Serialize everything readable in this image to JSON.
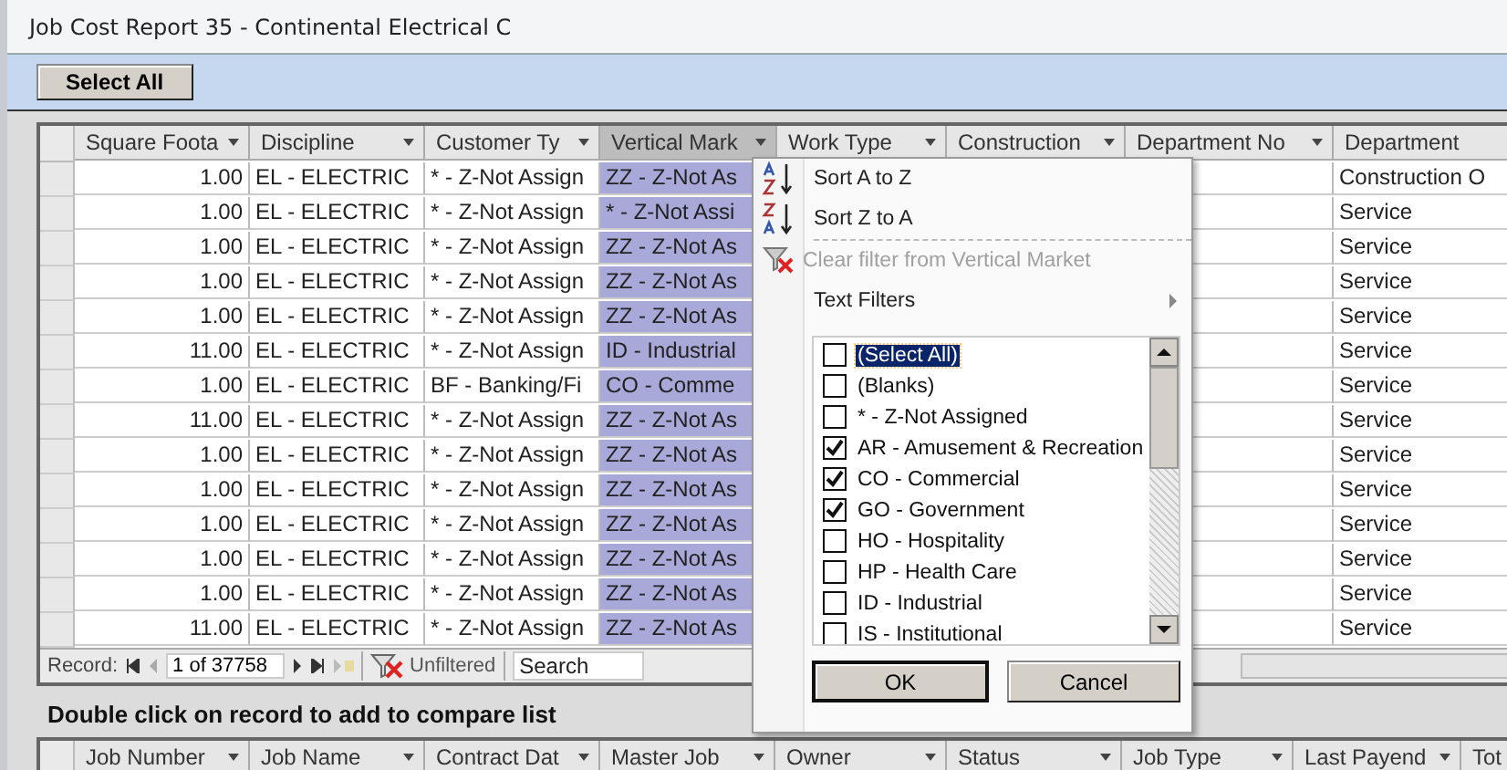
{
  "window": {
    "title": "Job Cost Report 35 - Continental Electrical C"
  },
  "toolbar": {
    "select_all_button": "Select All"
  },
  "records_grid": {
    "columns": [
      {
        "label": "Square Foota",
        "selected": false
      },
      {
        "label": "Discipline",
        "selected": false
      },
      {
        "label": "Customer Ty",
        "selected": false
      },
      {
        "label": "Vertical Mark",
        "selected": true
      },
      {
        "label": "Work Type",
        "selected": false
      },
      {
        "label": "Construction",
        "selected": false
      },
      {
        "label": "Department No",
        "selected": false
      },
      {
        "label": "Department",
        "selected": false
      }
    ],
    "rows": [
      {
        "square_footage": "1.00",
        "discipline": "EL - ELECTRIC",
        "customer_type": "* - Z-Not Assign",
        "vertical_market": "ZZ - Z-Not As",
        "department": "Construction O"
      },
      {
        "square_footage": "1.00",
        "discipline": "EL - ELECTRIC",
        "customer_type": "* - Z-Not Assign",
        "vertical_market": "* - Z-Not Assi",
        "department": "Service"
      },
      {
        "square_footage": "1.00",
        "discipline": "EL - ELECTRIC",
        "customer_type": "* - Z-Not Assign",
        "vertical_market": "ZZ - Z-Not As",
        "department": "Service"
      },
      {
        "square_footage": "1.00",
        "discipline": "EL - ELECTRIC",
        "customer_type": "* - Z-Not Assign",
        "vertical_market": "ZZ - Z-Not As",
        "department": "Service"
      },
      {
        "square_footage": "1.00",
        "discipline": "EL - ELECTRIC",
        "customer_type": "* - Z-Not Assign",
        "vertical_market": "ZZ - Z-Not As",
        "department": "Service"
      },
      {
        "square_footage": "11.00",
        "discipline": "EL - ELECTRIC",
        "customer_type": "* - Z-Not Assign",
        "vertical_market": "ID - Industrial",
        "department": "Service"
      },
      {
        "square_footage": "1.00",
        "discipline": "EL - ELECTRIC",
        "customer_type": "BF - Banking/Fi",
        "vertical_market": "CO - Comme",
        "department": "Service"
      },
      {
        "square_footage": "11.00",
        "discipline": "EL - ELECTRIC",
        "customer_type": "* - Z-Not Assign",
        "vertical_market": "ZZ - Z-Not As",
        "department": "Service"
      },
      {
        "square_footage": "1.00",
        "discipline": "EL - ELECTRIC",
        "customer_type": "* - Z-Not Assign",
        "vertical_market": "ZZ - Z-Not As",
        "department": "Service"
      },
      {
        "square_footage": "1.00",
        "discipline": "EL - ELECTRIC",
        "customer_type": "* - Z-Not Assign",
        "vertical_market": "ZZ - Z-Not As",
        "department": "Service"
      },
      {
        "square_footage": "1.00",
        "discipline": "EL - ELECTRIC",
        "customer_type": "* - Z-Not Assign",
        "vertical_market": "ZZ - Z-Not As",
        "department": "Service"
      },
      {
        "square_footage": "1.00",
        "discipline": "EL - ELECTRIC",
        "customer_type": "* - Z-Not Assign",
        "vertical_market": "ZZ - Z-Not As",
        "department": "Service"
      },
      {
        "square_footage": "1.00",
        "discipline": "EL - ELECTRIC",
        "customer_type": "* - Z-Not Assign",
        "vertical_market": "ZZ - Z-Not As",
        "department": "Service"
      },
      {
        "square_footage": "11.00",
        "discipline": "EL - ELECTRIC",
        "customer_type": "* - Z-Not Assign",
        "vertical_market": "ZZ - Z-Not As",
        "department": "Service"
      }
    ]
  },
  "navigator": {
    "label": "Record:",
    "position": "1 of 37758",
    "filter_status": "Unfiltered",
    "search_placeholder": "Search"
  },
  "compare_hint": "Double click on record to add to compare list",
  "compare_grid": {
    "columns": [
      "Job Number",
      "Job Name",
      "Contract Dat",
      "Master Job",
      "Owner",
      "Status",
      "Job Type",
      "Last Payend",
      "Tot"
    ]
  },
  "filter_menu": {
    "items": [
      {
        "kind": "sort-asc",
        "label": "Sort A to Z",
        "disabled": false
      },
      {
        "kind": "sort-desc",
        "label": "Sort Z to A",
        "disabled": false
      },
      {
        "kind": "clear",
        "label": "Clear filter from Vertical Market",
        "disabled": true
      },
      {
        "kind": "submenu",
        "label": "Text Filters",
        "disabled": false
      }
    ],
    "values": [
      {
        "label": "(Select All)",
        "checked": false,
        "selected": true
      },
      {
        "label": "(Blanks)",
        "checked": false,
        "selected": false
      },
      {
        "label": "* - Z-Not Assigned",
        "checked": false,
        "selected": false
      },
      {
        "label": "AR - Amusement & Recreation",
        "checked": true,
        "selected": false
      },
      {
        "label": "CO - Commercial",
        "checked": true,
        "selected": false
      },
      {
        "label": "GO - Government",
        "checked": true,
        "selected": false
      },
      {
        "label": "HO - Hospitality",
        "checked": false,
        "selected": false
      },
      {
        "label": "HP - Health Care",
        "checked": false,
        "selected": false
      },
      {
        "label": "ID - Industrial",
        "checked": false,
        "selected": false
      },
      {
        "label": "IS - Institutional",
        "checked": false,
        "selected": false
      }
    ],
    "buttons": [
      "OK",
      "Cancel"
    ]
  }
}
